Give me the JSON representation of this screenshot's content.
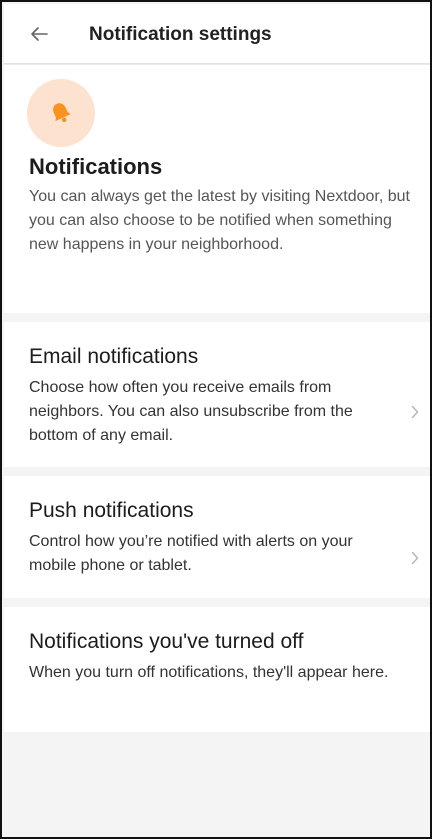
{
  "header": {
    "back_icon": "arrow-left-icon",
    "title": "Notification settings"
  },
  "intro": {
    "icon": "bell-icon",
    "title": "Notifications",
    "description": "You can always get the latest by visiting Nextdoor, but you can also choose to be notified when something new happens in your neighborhood."
  },
  "sections": [
    {
      "title": "Email notifications",
      "description": "Choose how often you receive emails from neighbors. You can also unsubscribe from the bottom of any email.",
      "icon": "chevron-right-icon"
    },
    {
      "title": "Push notifications",
      "description": "Control how you’re notified with alerts on your mobile phone or tablet.",
      "icon": "chevron-right-icon"
    },
    {
      "title": "Notifications you've turned off",
      "description": "When you turn off notifications, they'll appear here."
    }
  ],
  "colors": {
    "accent": "#f7931e",
    "icon_bg": "#fde2cf",
    "background": "#f4f4f4",
    "surface": "#ffffff"
  }
}
